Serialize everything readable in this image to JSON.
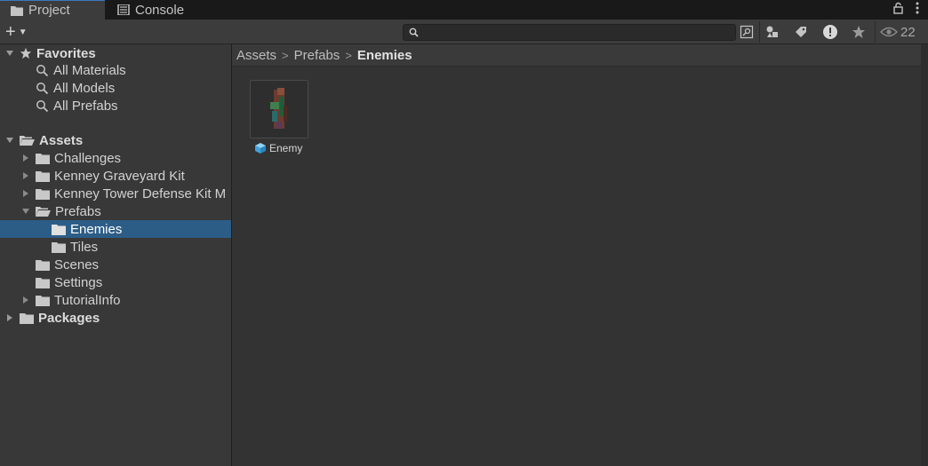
{
  "tabs": [
    {
      "label": "Project",
      "icon": "folder-icon",
      "active": true
    },
    {
      "label": "Console",
      "icon": "console-icon",
      "active": false
    }
  ],
  "toolbar": {
    "add_label": "+",
    "search_placeholder": "",
    "hidden_count": "22"
  },
  "tree": {
    "favorites": {
      "label": "Favorites",
      "items": [
        "All Materials",
        "All Models",
        "All Prefabs"
      ]
    },
    "assets": {
      "label": "Assets",
      "items": [
        {
          "label": "Challenges",
          "expandable": true
        },
        {
          "label": "Kenney Graveyard Kit",
          "expandable": true
        },
        {
          "label": "Kenney Tower Defense Kit M",
          "expandable": true
        },
        {
          "label": "Prefabs",
          "expandable": true,
          "expanded": true
        },
        {
          "label": "Enemies",
          "selected": true
        },
        {
          "label": "Tiles"
        },
        {
          "label": "Scenes"
        },
        {
          "label": "Settings"
        },
        {
          "label": "TutorialInfo",
          "expandable": true
        }
      ]
    },
    "packages": {
      "label": "Packages"
    }
  },
  "breadcrumb": [
    "Assets",
    "Prefabs",
    "Enemies"
  ],
  "assets_grid": [
    {
      "name": "Enemy",
      "icon": "prefab-cube-icon"
    }
  ],
  "colors": {
    "selection": "#2c5d87",
    "prefab_blue": "#4fb3e8",
    "tab_accent": "#3a79bb"
  }
}
